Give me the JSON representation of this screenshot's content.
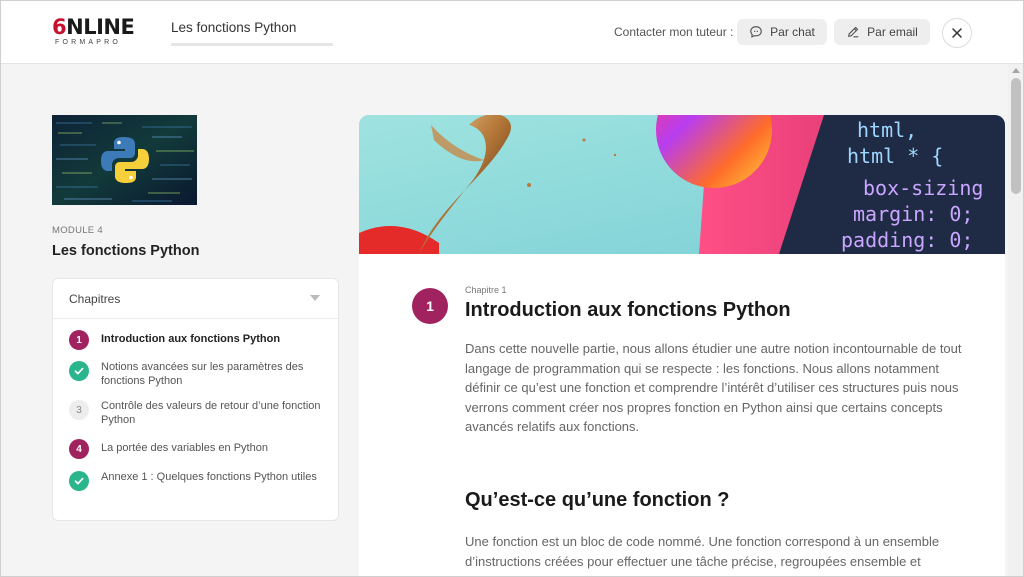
{
  "header": {
    "logo_main_o": "6",
    "logo_main_rest": "NLINE",
    "logo_sub": "FORMAPRO",
    "course_title": "Les fonctions Python",
    "progress": 0,
    "contact_label": "Contacter mon tuteur :",
    "chat_label": "Par chat",
    "email_label": "Par email"
  },
  "sidebar": {
    "module_label": "MODULE 4",
    "module_title": "Les fonctions Python",
    "chapters_heading": "Chapitres",
    "chapters": [
      {
        "badge": "1",
        "status": "current",
        "label": "Introduction aux fonctions Python"
      },
      {
        "badge": "",
        "status": "done",
        "label": "Notions avancées sur les paramètres des fonctions Python"
      },
      {
        "badge": "3",
        "status": "todo",
        "label": "Contrôle des valeurs de retour d’une fonction Python"
      },
      {
        "badge": "4",
        "status": "numbered",
        "label": "La portée des variables en Python"
      },
      {
        "badge": "",
        "status": "done",
        "label": "Annexe 1 : Quelques fonctions Python utiles"
      }
    ]
  },
  "hero_code": {
    "line1": "html,",
    "line2": "html * {",
    "line3": "box-sizing",
    "line4": "margin: 0;",
    "line5": "padding: 0;"
  },
  "main": {
    "chapter_number": "1",
    "chapter_kicker": "Chapitre 1",
    "chapter_title": "Introduction aux fonctions Python",
    "intro_text": "Dans cette nouvelle partie, nous allons étudier une autre notion incontournable de tout langage de programmation qui se respecte : les fonctions. Nous allons notamment définir ce qu’est une fonction et comprendre l’intérêt d’utiliser ces structures puis nous verrons comment créer nos propres fonction en Python ainsi que certains concepts avancés relatifs aux fonctions.",
    "section_title": "Qu’est-ce qu’une fonction ?",
    "section_text": "Une fonction est un bloc de code nommé. Une fonction correspond à un ensemble d’instructions créées pour effectuer une tâche précise, regroupées ensemble et"
  },
  "colors": {
    "accent": "#a0235f",
    "done": "#2bb58d",
    "brand_red": "#c8102e"
  }
}
